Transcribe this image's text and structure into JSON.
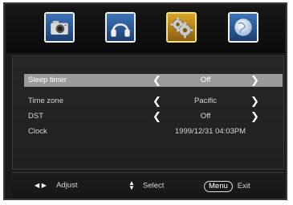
{
  "tabs": [
    {
      "icon": "camera-icon"
    },
    {
      "icon": "headphones-icon"
    },
    {
      "icon": "gear-icon",
      "active": true
    },
    {
      "icon": "globe-icon"
    }
  ],
  "settings": {
    "sleep_timer": {
      "label": "Sleep timer",
      "value": "Off",
      "selected": true
    },
    "time_zone": {
      "label": "Time zone",
      "value": "Pacific"
    },
    "dst": {
      "label": "DST",
      "value": "Off"
    },
    "clock": {
      "label": "Clock",
      "value": "1999/12/31 04:03PM"
    }
  },
  "help": {
    "adjust": "Adjust",
    "select": "Select",
    "menu_key": "Menu",
    "exit": "Exit"
  },
  "colors": {
    "background": "#1a1a1a",
    "selected_row": "#9a9a9a",
    "active_tab_border": "#f7e27a",
    "tab_blue": "#2d5c9e"
  }
}
